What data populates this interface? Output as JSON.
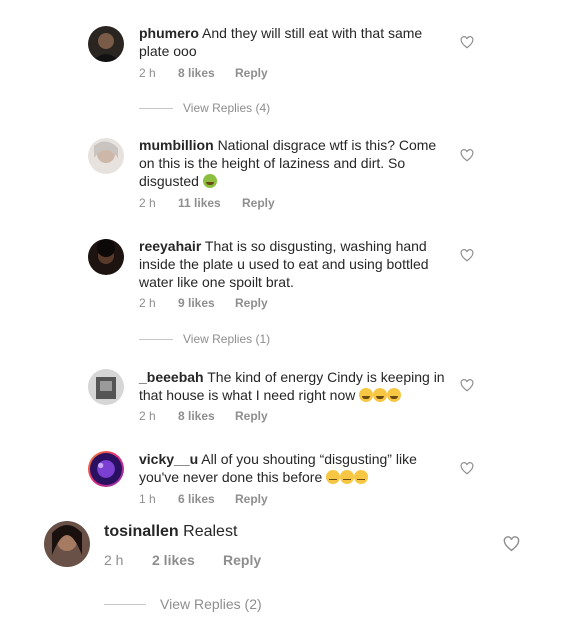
{
  "comments": [
    {
      "username": "phumero",
      "text": "And they will still eat with that same plate ooo",
      "time": "2 h",
      "likes": "8 likes",
      "reply": "Reply",
      "view_replies": "View Replies (4)",
      "avatar_color": "#2b2522"
    },
    {
      "username": "mumbillion",
      "text": "National disgrace wtf is this? Come on this is the height of laziness and dirt. So disgusted",
      "emoji": "nauseated-face-emoji",
      "time": "2 h",
      "likes": "11 likes",
      "reply": "Reply",
      "avatar_color": "#d9d1cc"
    },
    {
      "username": "reeyahair",
      "text": "That is so disgusting, washing hand inside the plate u used to eat and using bottled water like one spoilt brat.",
      "time": "2 h",
      "likes": "9 likes",
      "reply": "Reply",
      "view_replies": "View Replies (1)",
      "avatar_color": "#1d1411"
    },
    {
      "username": "_beeebah",
      "text": "The kind of energy Cindy is keeping in that house is what I need right now",
      "emoji": "laughing-face-emoji",
      "time": "2 h",
      "likes": "8 likes",
      "reply": "Reply",
      "avatar_color": "#6e6e6e"
    },
    {
      "username": "vicky__u",
      "text": "All of you shouting “disgusting” like you've never done this before",
      "emoji": "rolling-eyes-emoji",
      "time": "1 h",
      "likes": "6 likes",
      "reply": "Reply",
      "avatar_color": "#4a1f8a"
    },
    {
      "username": "tosinallen",
      "text": "Realest",
      "time": "2 h",
      "likes": "2 likes",
      "reply": "Reply",
      "view_replies": "View Replies (2)",
      "avatar_color": "#3a2a24"
    }
  ],
  "icons": {
    "like": "heart-outline-icon"
  },
  "colors": {
    "text": "#262626",
    "meta": "#8e8e8e",
    "divider": "#c7c7c7"
  }
}
